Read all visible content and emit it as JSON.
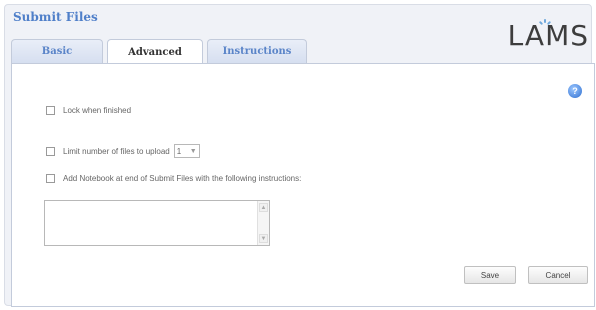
{
  "header": {
    "title": "Submit Files",
    "logo_text": "LAMS"
  },
  "tabs": [
    {
      "label": "Basic",
      "active": false
    },
    {
      "label": "Advanced",
      "active": true
    },
    {
      "label": "Instructions",
      "active": false
    }
  ],
  "options": {
    "lock_label": "Lock when finished",
    "limit_label": "Limit number of files to upload",
    "limit_value": "1",
    "notebook_label": "Add Notebook at end of Submit Files with the following instructions:"
  },
  "notebook_instructions": "",
  "buttons": {
    "save": "Save",
    "cancel": "Cancel"
  },
  "icons": {
    "help": "help-icon",
    "dropdown": "chevron-down-icon"
  },
  "colors": {
    "accent": "#4f7fc9",
    "help": "#2f6fd0"
  }
}
